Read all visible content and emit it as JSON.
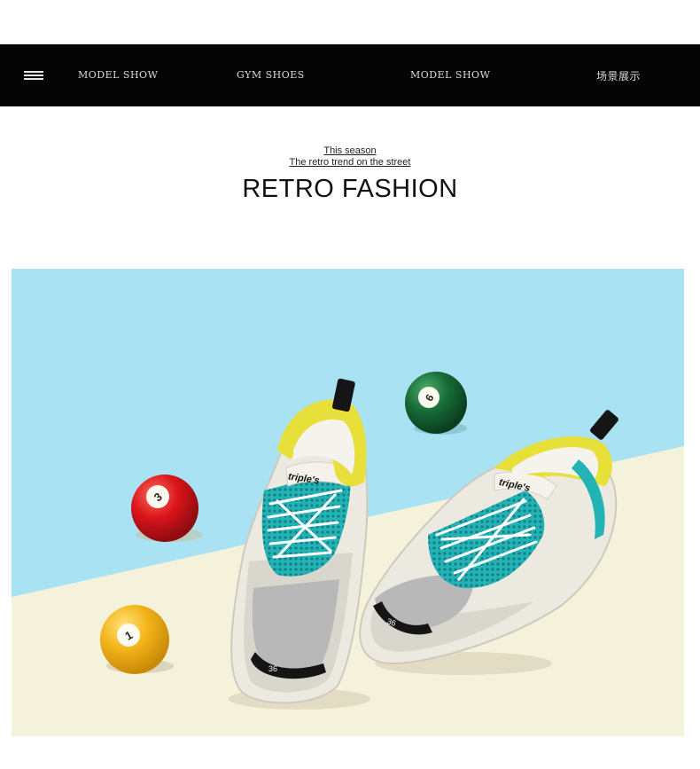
{
  "nav": {
    "items": [
      "MODEL SHOW",
      "GYM SHOES",
      "MODEL SHOW",
      "场景展示"
    ]
  },
  "heading": {
    "subtitle_1": "This season",
    "subtitle_2": "The retro trend on the street",
    "title": "RETRO FASHION"
  },
  "photo": {
    "colors": {
      "sky": "#a9e2f3",
      "floor": "#f5f2dc",
      "ball_red": "#d9141b",
      "ball_green": "#166b37",
      "ball_yellow": "#f3b318",
      "mesh_teal": "#24b3b5",
      "accent_yellow": "#e7e03a"
    },
    "shoe_brand": "triple's",
    "shoe_size": "36",
    "ball_numbers": [
      "3",
      "1",
      "6"
    ]
  }
}
